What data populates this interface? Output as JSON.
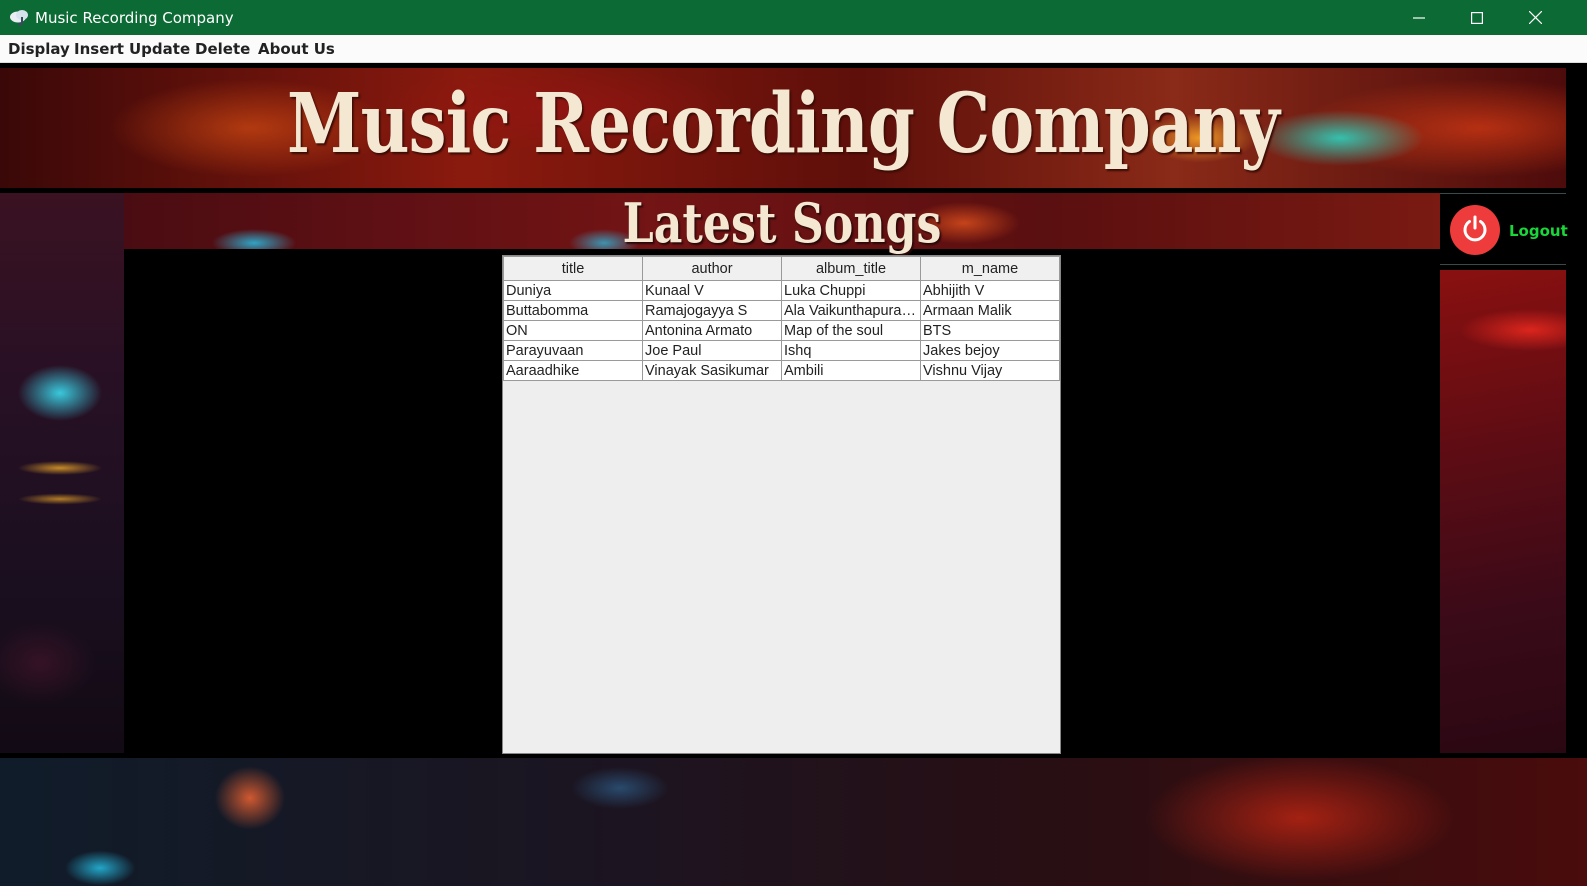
{
  "window": {
    "title": "Music Recording Company",
    "app_icon": "cloud-music-icon",
    "controls": [
      "minimize-icon",
      "maximize-icon",
      "close-icon"
    ]
  },
  "menu": {
    "items": [
      "Display",
      "Insert",
      "Update",
      "Delete",
      "About Us"
    ]
  },
  "banner": {
    "title": "Music Recording Company"
  },
  "section": {
    "title": "Latest Songs"
  },
  "logout": {
    "label": "Logout",
    "icon": "power-icon"
  },
  "table": {
    "columns": [
      "title",
      "author",
      "album_title",
      "m_name"
    ],
    "rows": [
      [
        "Duniya",
        "Kunaal V",
        "Luka Chuppi",
        "Abhijith V"
      ],
      [
        "Buttabomma",
        "Ramajogayya S",
        "Ala Vaikunthapuram...",
        "Armaan Malik"
      ],
      [
        "ON",
        "Antonina Armato",
        "Map of the soul",
        "BTS"
      ],
      [
        "Parayuvaan",
        "Joe Paul",
        "Ishq",
        "Jakes bejoy"
      ],
      [
        "Aaraadhike",
        "Vinayak Sasikumar",
        "Ambili",
        "Vishnu Vijay"
      ]
    ]
  },
  "colors": {
    "titlebar": "#0c6b35",
    "logout_text": "#19d63a",
    "power_button": "#ee3b3b"
  }
}
